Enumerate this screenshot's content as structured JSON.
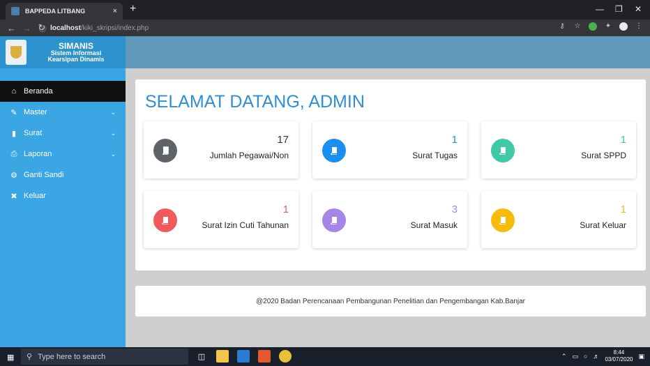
{
  "browser": {
    "tab_title": "BAPPEDA LITBANG",
    "tab_close": "×",
    "new_tab": "+",
    "url_host": "localhost",
    "url_path": "/kiki_skripsi/index.php"
  },
  "sidebar": {
    "brand_name": "SIMANIS",
    "brand_sub1": "Sistem Informasi",
    "brand_sub2": "Kearsipan Dinamis",
    "items": [
      {
        "label": "Beranda",
        "icon": "home-icon",
        "active": true,
        "caret": false
      },
      {
        "label": "Master",
        "icon": "pencil-icon",
        "active": false,
        "caret": true
      },
      {
        "label": "Surat",
        "icon": "book-icon",
        "active": false,
        "caret": true
      },
      {
        "label": "Laporan",
        "icon": "print-icon",
        "active": false,
        "caret": true
      },
      {
        "label": "Ganti Sandi",
        "icon": "gear-icon",
        "active": false,
        "caret": false
      },
      {
        "label": "Keluar",
        "icon": "close-icon",
        "active": false,
        "caret": false
      }
    ]
  },
  "main": {
    "welcome": "SELAMAT DATANG, ADMIN",
    "stats": [
      {
        "value": "17",
        "label": "Jumlah Pegawai/Non",
        "icon_color": "#5f6368",
        "value_color": "#333333"
      },
      {
        "value": "1",
        "label": "Surat Tugas",
        "icon_color": "#1a8ff0",
        "value_color": "#1a8ff0"
      },
      {
        "value": "1",
        "label": "Surat SPPD",
        "icon_color": "#3ec9a7",
        "value_color": "#3ec9a7"
      },
      {
        "value": "1",
        "label": "Surat Izin Cuti Tahunan",
        "icon_color": "#f05a5a",
        "value_color": "#f05a5a"
      },
      {
        "value": "3",
        "label": "Surat Masuk",
        "icon_color": "#a585e6",
        "value_color": "#a585e6"
      },
      {
        "value": "1",
        "label": "Surat Keluar",
        "icon_color": "#f7bb0c",
        "value_color": "#f7bb0c"
      }
    ],
    "footer": "@2020 Badan Perencanaan Pembangunan Penelitian dan Pengembangan Kab.Banjar"
  },
  "taskbar": {
    "search_placeholder": "Type here to search",
    "time": "8:44",
    "date": "03/07/2020"
  }
}
